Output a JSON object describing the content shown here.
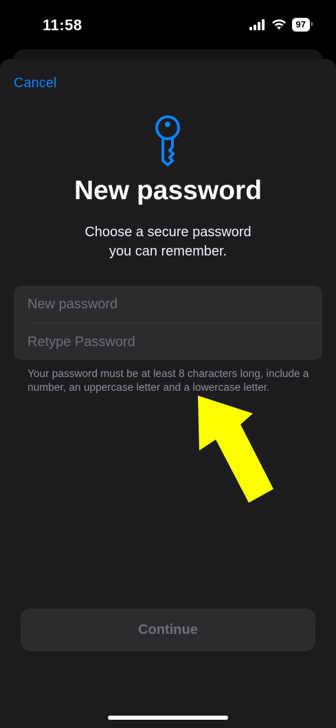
{
  "status_bar": {
    "time": "11:58",
    "battery": "97",
    "icons": [
      "signal-icon",
      "wifi-icon",
      "battery-icon"
    ]
  },
  "header": {
    "cancel_label": "Cancel"
  },
  "main": {
    "icon": "key-icon",
    "title": "New password",
    "subtitle_line1": "Choose a secure password",
    "subtitle_line2": "you can remember.",
    "fields": {
      "new_password_placeholder": "New password",
      "retype_password_placeholder": "Retype Password",
      "new_password_value": "",
      "retype_password_value": ""
    },
    "hint": "Your password must be at least 8 characters long, include a number, an uppercase letter and a lowercase letter.",
    "continue_label": "Continue"
  },
  "annotation": {
    "icon": "arrow-icon",
    "color": "#FFFF00"
  },
  "colors": {
    "accent": "#0A84FF",
    "sheet_bg": "#1C1C1E",
    "field_bg": "#2C2C2E"
  }
}
